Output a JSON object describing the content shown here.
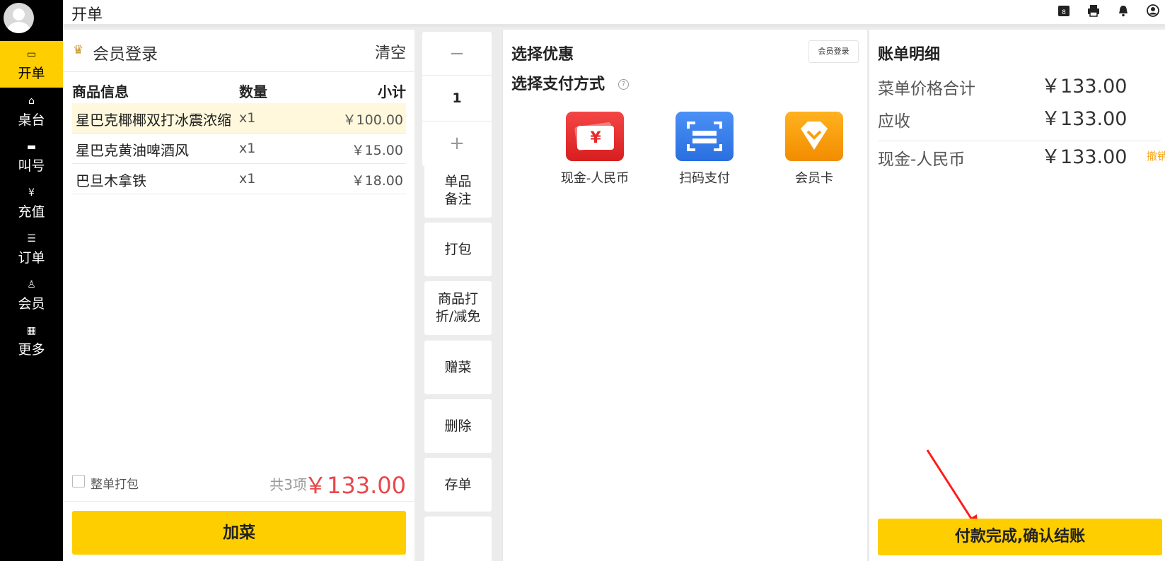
{
  "sidebar": {
    "items": [
      {
        "label": "开单",
        "icon": "cashier-icon",
        "active": true
      },
      {
        "label": "桌台",
        "icon": "table-icon",
        "active": false
      },
      {
        "label": "叫号",
        "icon": "ticket-icon",
        "active": false
      },
      {
        "label": "充值",
        "icon": "yen-coin-icon",
        "active": false
      },
      {
        "label": "订单",
        "icon": "order-list-icon",
        "active": false
      },
      {
        "label": "会员",
        "icon": "member-icon",
        "active": false
      },
      {
        "label": "更多",
        "icon": "grid-icon",
        "active": false
      }
    ]
  },
  "header": {
    "title": "开单",
    "icons": [
      "queue-number-icon",
      "printer-icon",
      "bell-icon",
      "user-icon"
    ],
    "queue_badge": "8"
  },
  "order": {
    "member_login": "会员登录",
    "clear": "清空",
    "columns": {
      "name": "商品信息",
      "qty": "数量",
      "subtotal": "小计"
    },
    "items": [
      {
        "name": "星巴克椰椰双打冰震浓缩",
        "qty": "x1",
        "subtotal": "￥100.00",
        "selected": true
      },
      {
        "name": "星巴克黄油啤酒风",
        "qty": "x1",
        "subtotal": "￥15.00",
        "selected": false
      },
      {
        "name": "巴旦木拿铁",
        "qty": "x1",
        "subtotal": "￥18.00",
        "selected": false
      }
    ],
    "pack_all_label": "整单打包",
    "count_label": "共3项",
    "total": "￥133.00",
    "add_button": "加菜"
  },
  "actions": {
    "minus": "−",
    "quantity": "1",
    "plus": "+",
    "buttons": [
      {
        "label": "单品\n备注"
      },
      {
        "label": "打包"
      },
      {
        "label": "商品打\n折/减免"
      },
      {
        "label": "赠菜"
      },
      {
        "label": "删除"
      },
      {
        "label": "存单"
      }
    ]
  },
  "payment": {
    "discount_title": "选择优惠",
    "member_login_small": "会员登录",
    "pay_title": "选择支付方式",
    "help": "?",
    "methods": [
      {
        "label": "现金-人民币",
        "icon": "cash-yen-icon",
        "color": "#e8292b"
      },
      {
        "label": "扫码支付",
        "icon": "scan-qr-icon",
        "color": "#3a82ee"
      },
      {
        "label": "会员卡",
        "icon": "member-card-icon",
        "color": "#f9a00e"
      }
    ]
  },
  "bill": {
    "title": "账单明细",
    "rows": [
      {
        "label": "菜单价格合计",
        "value": "￥133.00"
      },
      {
        "label": "应收",
        "value": "￥133.00"
      }
    ],
    "payment_row": {
      "label": "现金-人民币",
      "value": "￥133.00",
      "action": "撤销"
    },
    "confirm_button": "付款完成,确认结账"
  },
  "colors": {
    "accent": "#ffce00",
    "total_red": "#e8474c",
    "undo_orange": "#f5a623",
    "selected_row": "#fff8dd"
  }
}
